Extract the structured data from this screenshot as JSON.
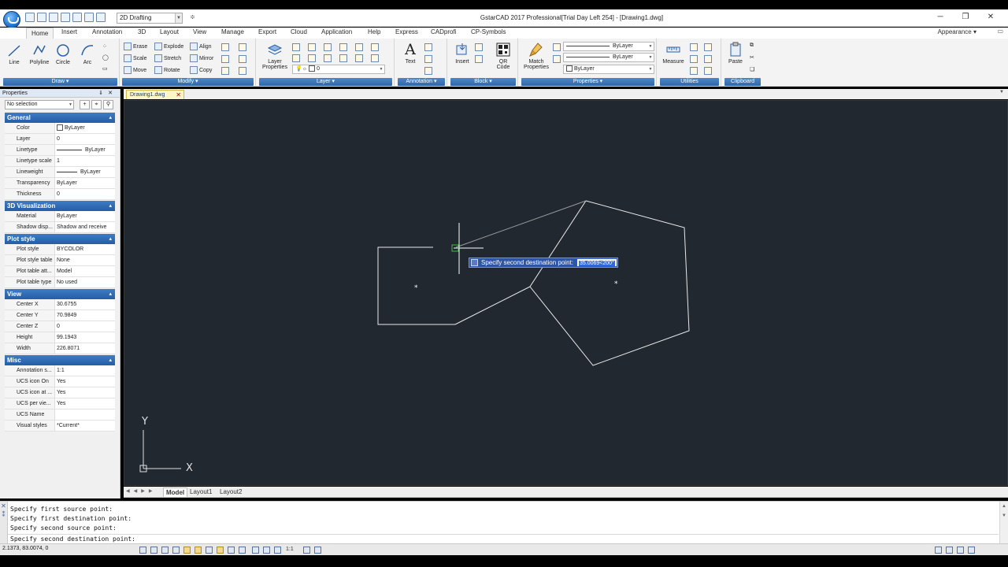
{
  "app": {
    "title": "GstarCAD 2017 Professional[Trial Day Left 254] - [Drawing1.dwg]",
    "workspace": "2D Drafting",
    "appearance": "Appearance"
  },
  "menu_tabs": [
    "Home",
    "Insert",
    "Annotation",
    "3D",
    "Layout",
    "View",
    "Manage",
    "Export",
    "Cloud",
    "Application",
    "Help",
    "Express",
    "CADprofi",
    "CP-Symbols"
  ],
  "ribbon": {
    "draw": {
      "label": "Draw",
      "tools": [
        "Line",
        "Polyline",
        "Circle",
        "Arc"
      ]
    },
    "modify": {
      "label": "Modify",
      "tools": [
        "Erase",
        "Explode",
        "Align",
        "Scale",
        "Stretch",
        "Mirror",
        "Move",
        "Rotate",
        "Copy"
      ]
    },
    "layer": {
      "label": "Layer",
      "properties": "Layer Properties",
      "current_layer": "0"
    },
    "annotation": {
      "label": "Annotation",
      "text": "Text"
    },
    "block": {
      "label": "Block",
      "insert": "Insert",
      "qr": "QR Code"
    },
    "properties": {
      "label": "Properties",
      "match": "Match Properties",
      "color": "ByLayer",
      "linetype": "ByLayer",
      "lineweight": "ByLayer"
    },
    "utilities": {
      "label": "Utilities",
      "measure": "Measure"
    },
    "clipboard": {
      "label": "Clipboard",
      "paste": "Paste"
    }
  },
  "properties_panel": {
    "title": "Properties",
    "selection": "No selection",
    "sections": [
      {
        "name": "General",
        "rows": [
          [
            "Color",
            "ByLayer"
          ],
          [
            "Layer",
            "0"
          ],
          [
            "Linetype",
            "ByLayer"
          ],
          [
            "Linetype scale",
            "1"
          ],
          [
            "Lineweight",
            "ByLayer"
          ],
          [
            "Transparency",
            "ByLayer"
          ],
          [
            "Thickness",
            "0"
          ]
        ]
      },
      {
        "name": "3D Visualization",
        "rows": [
          [
            "Material",
            "ByLayer"
          ],
          [
            "Shadow disp...",
            "Shadow and receive"
          ]
        ]
      },
      {
        "name": "Plot style",
        "rows": [
          [
            "Plot style",
            "BYCOLOR"
          ],
          [
            "Plot style table",
            "None"
          ],
          [
            "Plot table att...",
            "Model"
          ],
          [
            "Plot table type",
            "No used"
          ]
        ]
      },
      {
        "name": "View",
        "rows": [
          [
            "Center X",
            "30.6755"
          ],
          [
            "Center Y",
            "70.9849"
          ],
          [
            "Center Z",
            "0"
          ],
          [
            "Height",
            "99.1943"
          ],
          [
            "Width",
            "226.8071"
          ]
        ]
      },
      {
        "name": "Misc",
        "rows": [
          [
            "Annotation s...",
            "1:1"
          ],
          [
            "UCS icon On",
            "Yes"
          ],
          [
            "UCS icon at ...",
            "Yes"
          ],
          [
            "UCS per vie...",
            "Yes"
          ],
          [
            "UCS Name",
            ""
          ],
          [
            "Visual styles",
            "*Current*"
          ]
        ]
      }
    ]
  },
  "document_tab": "Drawing1.dwg",
  "canvas": {
    "prompt": "Specify second destination point:",
    "input_value": "35.0069<200°",
    "ucs_y": "Y",
    "ucs_x": "X"
  },
  "layout_tabs": [
    "Model",
    "Layout1",
    "Layout2"
  ],
  "command_history": [
    "Specify first source point:",
    "Specify first destination point:",
    "Specify second source point:",
    "Specify second destination point:"
  ],
  "status": {
    "coords": "2.1373, 83.0074, 0",
    "scale": "1:1"
  }
}
